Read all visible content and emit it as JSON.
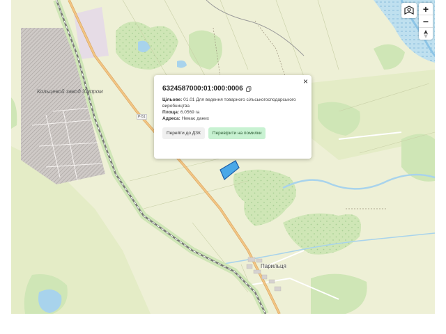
{
  "map": {
    "colors": {
      "land": "#eef0d6",
      "forest": "#cfe6b6",
      "water": "#a8d3ec",
      "road_major": "#f2c585",
      "railway": "#8a8a8a",
      "industrial": "#e2dfe4",
      "parcel": "#4aa8e8"
    },
    "labels": {
      "factory": "Кольцевой завод Хмпром",
      "village": "Парильця",
      "road_ref": "Р-51"
    }
  },
  "controls": {
    "layers_icon": "layers-icon",
    "zoom_in": "+",
    "zoom_out": "−",
    "compass": "compass-icon"
  },
  "popup": {
    "cadastral_number": "6324587000:01:000:0006",
    "purpose_label": "Цільове:",
    "purpose_value": "01.01 Для ведення товарного сільськогосподарського виробництва",
    "area_label": "Площа:",
    "area_value": "6.0569 га",
    "address_label": "Адреса:",
    "address_value": "Немає даних",
    "btn_dzk": "Перейти до ДЗК",
    "btn_check": "Перевірити на помилки",
    "close": "×"
  }
}
